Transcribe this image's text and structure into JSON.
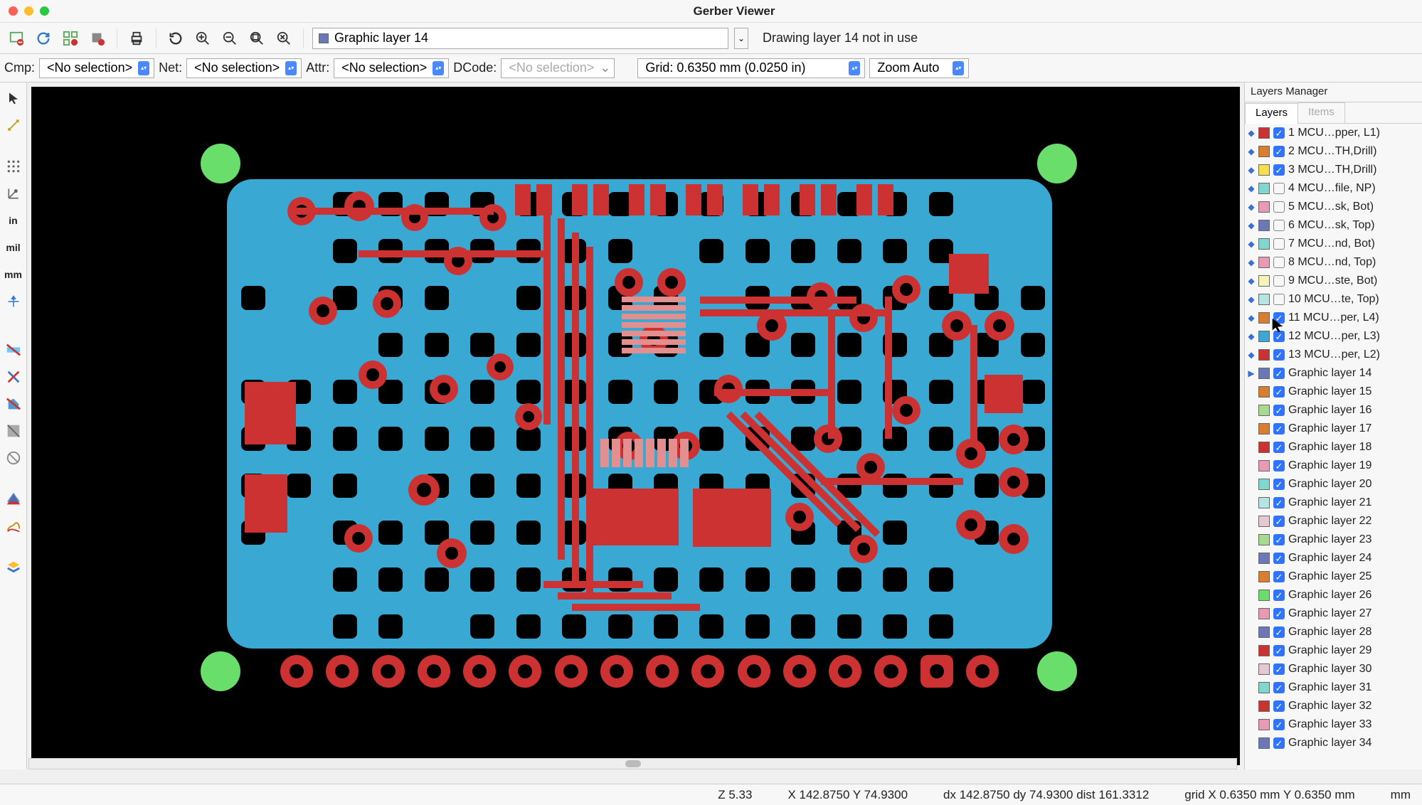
{
  "window": {
    "title": "Gerber Viewer"
  },
  "toolbar1": {
    "layer_selector": "Graphic layer 14",
    "status": "Drawing layer 14 not in use"
  },
  "toolbar2": {
    "cmp_label": "Cmp:",
    "cmp_value": "<No selection>",
    "net_label": "Net:",
    "net_value": "<No selection>",
    "attr_label": "Attr:",
    "attr_value": "<No selection>",
    "dcode_label": "DCode:",
    "dcode_value": "<No selection>",
    "grid_value": "Grid: 0.6350 mm (0.0250 in)",
    "zoom_value": "Zoom Auto"
  },
  "left_tools": {
    "in": "in",
    "mil": "mil",
    "mm": "mm"
  },
  "layers_panel": {
    "title": "Layers Manager",
    "tab_layers": "Layers",
    "tab_items": "Items",
    "rows": [
      {
        "color": "#cc3232",
        "checked": true,
        "arrow": true,
        "label": "1 MCU…pper, L1)"
      },
      {
        "color": "#d97e2f",
        "checked": true,
        "arrow": true,
        "label": "2 MCU…TH,Drill)"
      },
      {
        "color": "#f5df4d",
        "checked": true,
        "arrow": true,
        "label": "3 MCU…TH,Drill)"
      },
      {
        "color": "#7fd7d0",
        "checked": false,
        "arrow": true,
        "label": "4 MCU…file, NP)"
      },
      {
        "color": "#e89ab5",
        "checked": false,
        "arrow": true,
        "label": "5 MCU…sk, Bot)"
      },
      {
        "color": "#6a78b8",
        "checked": false,
        "arrow": true,
        "label": "6 MCU…sk, Top)"
      },
      {
        "color": "#7fd7d0",
        "checked": false,
        "arrow": true,
        "label": "7 MCU…nd, Bot)"
      },
      {
        "color": "#e89ab5",
        "checked": false,
        "arrow": true,
        "label": "8 MCU…nd, Top)"
      },
      {
        "color": "#f5f3b6",
        "checked": false,
        "arrow": true,
        "label": "9 MCU…ste, Bot)"
      },
      {
        "color": "#b6e5e1",
        "checked": false,
        "arrow": true,
        "label": "10 MCU…te, Top)"
      },
      {
        "color": "#d97e2f",
        "checked": true,
        "arrow": true,
        "label": "11 MCU…per, L4)"
      },
      {
        "color": "#39a9d4",
        "checked": true,
        "arrow": true,
        "label": "12 MCU…per, L3)"
      },
      {
        "color": "#cc3232",
        "checked": true,
        "arrow": true,
        "label": "13 MCU…per, L2)"
      },
      {
        "color": "#6a78b8",
        "checked": true,
        "arrow": "tri",
        "label": "Graphic layer 14"
      },
      {
        "color": "#d97e2f",
        "checked": true,
        "arrow": false,
        "label": "Graphic layer 15"
      },
      {
        "color": "#a7d98f",
        "checked": true,
        "arrow": false,
        "label": "Graphic layer 16"
      },
      {
        "color": "#d97e2f",
        "checked": true,
        "arrow": false,
        "label": "Graphic layer 17"
      },
      {
        "color": "#cc3232",
        "checked": true,
        "arrow": false,
        "label": "Graphic layer 18"
      },
      {
        "color": "#e89ab5",
        "checked": true,
        "arrow": false,
        "label": "Graphic layer 19"
      },
      {
        "color": "#7fd7d0",
        "checked": true,
        "arrow": false,
        "label": "Graphic layer 20"
      },
      {
        "color": "#b6e5e1",
        "checked": true,
        "arrow": false,
        "label": "Graphic layer 21"
      },
      {
        "color": "#e7c8d1",
        "checked": true,
        "arrow": false,
        "label": "Graphic layer 22"
      },
      {
        "color": "#a7d98f",
        "checked": true,
        "arrow": false,
        "label": "Graphic layer 23"
      },
      {
        "color": "#6a78b8",
        "checked": true,
        "arrow": false,
        "label": "Graphic layer 24"
      },
      {
        "color": "#d97e2f",
        "checked": true,
        "arrow": false,
        "label": "Graphic layer 25"
      },
      {
        "color": "#6ade6a",
        "checked": true,
        "arrow": false,
        "label": "Graphic layer 26"
      },
      {
        "color": "#e89ab5",
        "checked": true,
        "arrow": false,
        "label": "Graphic layer 27"
      },
      {
        "color": "#6a78b8",
        "checked": true,
        "arrow": false,
        "label": "Graphic layer 28"
      },
      {
        "color": "#cc3232",
        "checked": true,
        "arrow": false,
        "label": "Graphic layer 29"
      },
      {
        "color": "#e7c8d1",
        "checked": true,
        "arrow": false,
        "label": "Graphic layer 30"
      },
      {
        "color": "#7fd7d0",
        "checked": true,
        "arrow": false,
        "label": "Graphic layer 31"
      },
      {
        "color": "#cc3232",
        "checked": true,
        "arrow": false,
        "label": "Graphic layer 32"
      },
      {
        "color": "#e89ab5",
        "checked": true,
        "arrow": false,
        "label": "Graphic layer 33"
      },
      {
        "color": "#6a78b8",
        "checked": true,
        "arrow": false,
        "label": "Graphic layer 34"
      }
    ]
  },
  "statusbar": {
    "zoom": "Z 5.33",
    "xy": "X 142.8750  Y 74.9300",
    "dxy": "dx 142.8750  dy 74.9300  dist 161.3312",
    "gridxy": "grid X 0.6350 mm  Y 0.6350 mm",
    "unit": "mm"
  }
}
